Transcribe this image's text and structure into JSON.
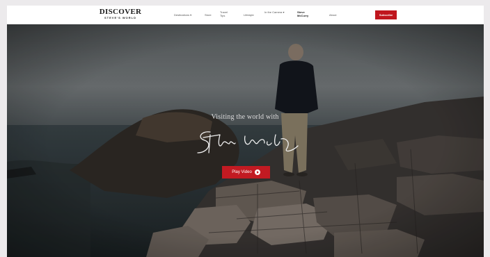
{
  "site": {
    "logo_main": "DISCOVER",
    "logo_sub": "STEVE'S WORLD"
  },
  "nav": {
    "items": [
      {
        "label": "Destinations",
        "suffix": "▾"
      },
      {
        "label": "Store",
        "suffix": ""
      },
      {
        "label": "Travel Tips",
        "suffix": ""
      },
      {
        "label": "Lifestyle",
        "suffix": ""
      },
      {
        "label": "In the Camera",
        "suffix": "▾"
      },
      {
        "label": "Steve McCurry",
        "suffix": ""
      },
      {
        "label": "About",
        "suffix": ""
      }
    ],
    "subscribe_label": "Subscribe"
  },
  "hero": {
    "headline": "Visiting the world with",
    "signature": "Steve McCurry",
    "play_label": "Play Video"
  }
}
